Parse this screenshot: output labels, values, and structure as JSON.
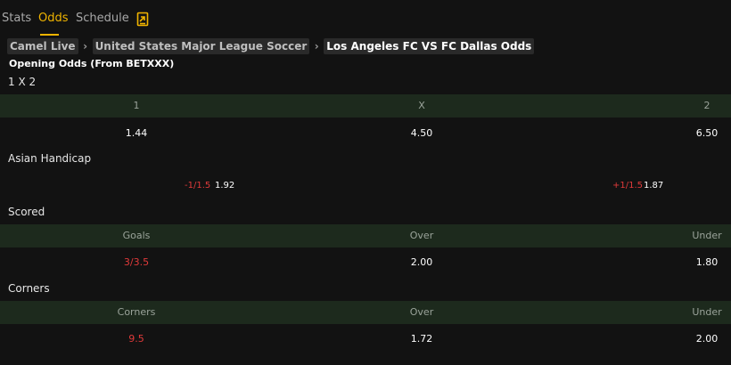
{
  "tabs": [
    {
      "label": "Stats",
      "active": false
    },
    {
      "label": "Odds",
      "active": true
    },
    {
      "label": "Schedule",
      "active": false
    }
  ],
  "breadcrumb": [
    "Camel Live",
    "United States Major League Soccer",
    "Los Angeles FC VS FC Dallas Odds"
  ],
  "opening_label": "Opening Odds (From BETXXX)",
  "sections": {
    "x12": {
      "title": "1 X 2",
      "headers": [
        "1",
        "X",
        "2"
      ],
      "values": [
        "1.44",
        "4.50",
        "6.50"
      ]
    },
    "asian_handicap": {
      "title": "Asian Handicap",
      "home_line": "-1/1.5",
      "home_odds": "1.92",
      "away_line": "+1/1.5",
      "away_odds": "1.87"
    },
    "scored": {
      "title": "Scored",
      "headers": [
        "Goals",
        "Over",
        "Under"
      ],
      "values": [
        "3/3.5",
        "2.00",
        "1.80"
      ]
    },
    "corners": {
      "title": "Corners",
      "headers": [
        "Corners",
        "Over",
        "Under"
      ],
      "values": [
        "9.5",
        "1.72",
        "2.00"
      ]
    }
  },
  "colors": {
    "accent": "#f0b400",
    "negative": "#e03a3a",
    "header_bg": "#1d2a1d"
  },
  "icons": {
    "tab_extra": "share-icon"
  }
}
